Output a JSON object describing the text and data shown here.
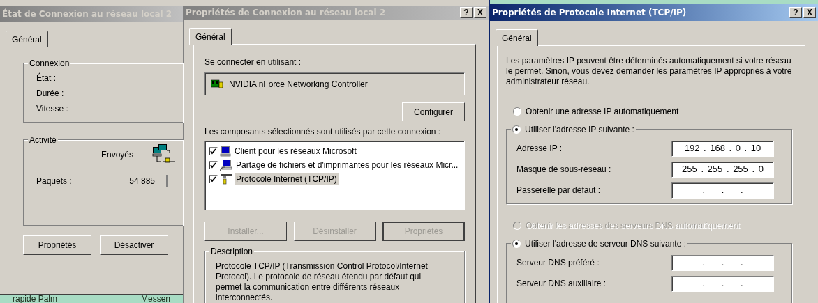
{
  "windows": [
    {
      "kind": "status",
      "title": "État de Connexion au réseau local 2",
      "active": false,
      "tabs": [
        {
          "label": "Général",
          "selected": true
        }
      ],
      "connection": {
        "legend": "Connexion",
        "rows": [
          "État :",
          "Durée :",
          "Vitesse :"
        ]
      },
      "activity": {
        "legend": "Activité",
        "sent_label": "Envoyés",
        "packets_label": "Paquets :",
        "packets_sent": "54 885"
      },
      "buttons": [
        {
          "label": "Propriétés",
          "disabled": false
        },
        {
          "label": "Désactiver",
          "disabled": false
        }
      ],
      "taskbar": [
        "rapide Palm",
        "Messen"
      ]
    },
    {
      "kind": "connection",
      "title": "Propriétés de Connexion au réseau local 2",
      "active": false,
      "title_buttons": [
        "?",
        "X"
      ],
      "tabs": [
        {
          "label": "Général",
          "selected": true
        }
      ],
      "connect_label": "Se connecter en utilisant :",
      "adapter": "NVIDIA nForce Networking Controller",
      "configure_button": "Configurer",
      "components_label": "Les composants sélectionnés sont utilisés par cette connexion :",
      "components": [
        {
          "kind": "client",
          "label": "Client pour les réseaux Microsoft",
          "checked": true,
          "selected": false
        },
        {
          "kind": "share",
          "label": "Partage de fichiers et d'imprimantes pour les réseaux Micr...",
          "checked": true,
          "selected": false
        },
        {
          "kind": "protocol",
          "label": "Protocole Internet (TCP/IP)",
          "checked": true,
          "selected": true
        }
      ],
      "buttons": [
        {
          "label": "Installer...",
          "disabled": true,
          "focused": false
        },
        {
          "label": "Désinstaller",
          "disabled": true,
          "focused": false
        },
        {
          "label": "Propriétés",
          "disabled": true,
          "focused": true
        }
      ],
      "description": {
        "legend": "Description",
        "text": "Protocole TCP/IP (Transmission Control Protocol/Internet Protocol). Le protocole de réseau étendu par défaut qui permet la communication entre différents réseaux interconnectés."
      }
    },
    {
      "kind": "tcpip",
      "title": "Propriétés de Protocole Internet (TCP/IP)",
      "active": true,
      "title_buttons": [
        "?",
        "X"
      ],
      "tabs": [
        {
          "label": "Général",
          "selected": true
        }
      ],
      "intro": "Les paramètres IP peuvent être déterminés automatiquement si votre réseau le permet. Sinon, vous devez demander les paramètres IP appropriés à votre administrateur réseau.",
      "ip_auto": {
        "label": "Obtenir une adresse IP automatiquement",
        "selected": false,
        "disabled": false
      },
      "ip_manual": {
        "label": "Utiliser l'adresse IP suivante :",
        "selected": true,
        "disabled": false,
        "fields": [
          {
            "label": "Adresse IP :",
            "value": "192 . 168 . 0 . 10"
          },
          {
            "label": "Masque de sous-réseau :",
            "value": "255 . 255 . 255 . 0"
          },
          {
            "label": "Passerelle par défaut :",
            "value": ". . ."
          }
        ]
      },
      "dns_auto": {
        "label": "Obtenir les adresses des serveurs DNS automatiquement",
        "selected": false,
        "disabled": true
      },
      "dns_manual": {
        "label": "Utiliser l'adresse de serveur DNS suivante :",
        "selected": true,
        "disabled": false,
        "fields": [
          {
            "label": "Serveur DNS préféré :",
            "value": ". . ."
          },
          {
            "label": "Serveur DNS auxiliaire :",
            "value": ". . ."
          }
        ]
      }
    }
  ]
}
